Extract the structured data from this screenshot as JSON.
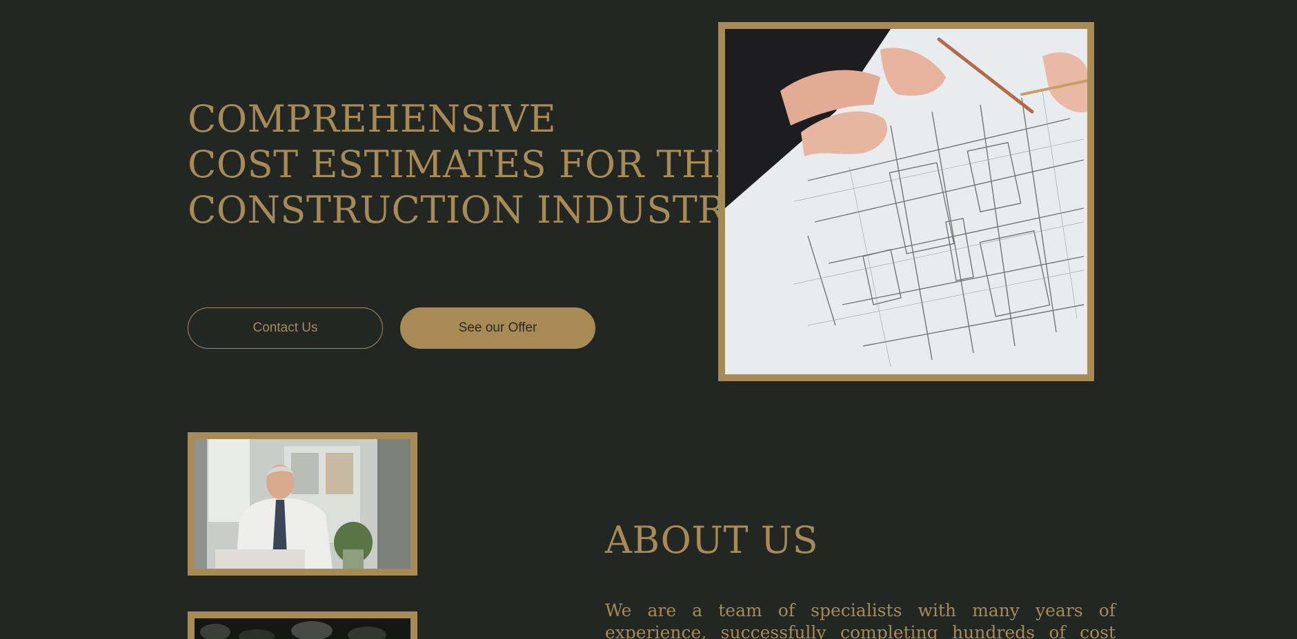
{
  "hero": {
    "heading_lines": [
      "COMPREHENSIVE",
      "COST ESTIMATES FOR THE",
      "CONSTRUCTION INDUSTRY."
    ],
    "buttons": {
      "contact_label": "Contact Us",
      "offer_label": "See our Offer"
    },
    "image_subject": "blueprint-review-photo"
  },
  "gallery": {
    "person_image": "businessman-portrait-photo",
    "third_image": "dark-foliage-photo"
  },
  "about": {
    "title": "ABOUT US",
    "text": "We are a team of specialists with many years of experience, successfully completing hundreds of cost estimates for"
  },
  "colors": {
    "background": "#232724",
    "accent": "#a88a55",
    "button_text_dark": "#262a27"
  }
}
